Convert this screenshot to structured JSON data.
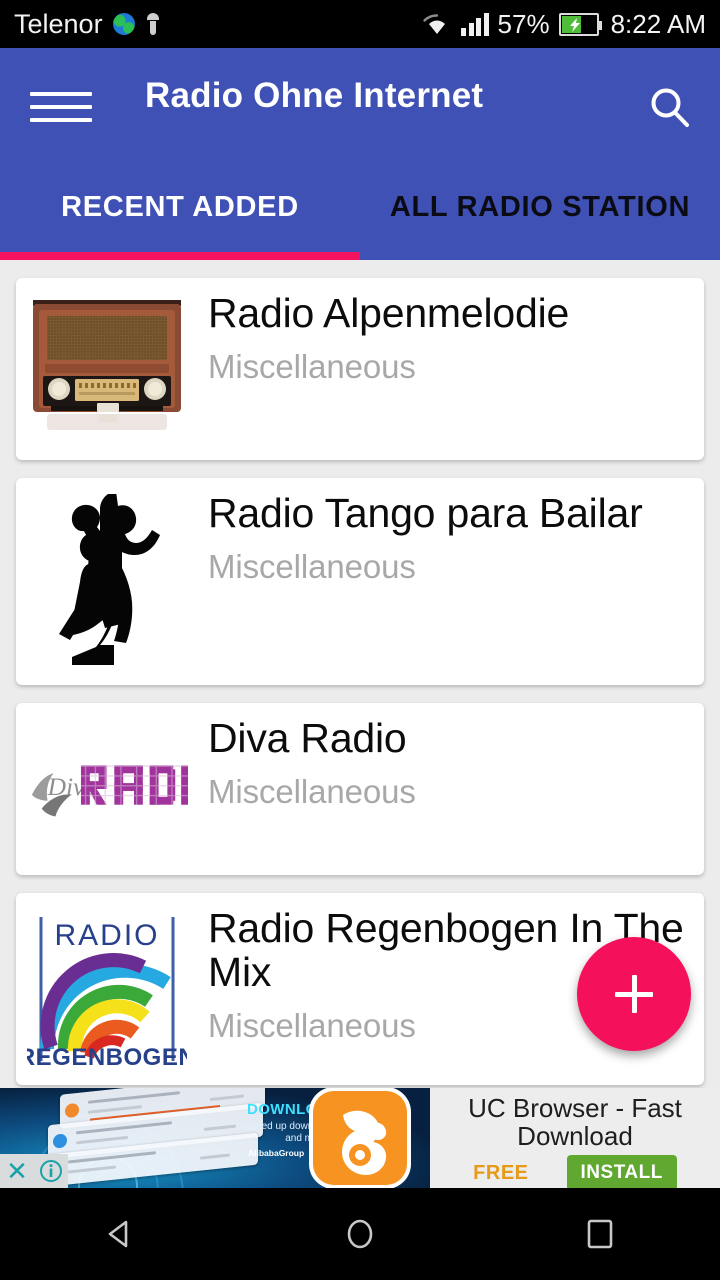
{
  "statusbar": {
    "carrier": "Telenor",
    "battery_percent": "57%",
    "clock": "8:22 AM",
    "icons": [
      "globe-icon",
      "android-icon",
      "wifi-icon",
      "signal-icon",
      "battery-icon"
    ]
  },
  "appbar": {
    "title": "Radio Ohne Internet",
    "menu_icon": "hamburger-menu-icon",
    "search_icon": "search-icon",
    "background_color": "#3f51b5",
    "indicator_color": "#f5125e"
  },
  "tabs": [
    {
      "label": "RECENT ADDED",
      "active": true
    },
    {
      "label": "ALL RADIO STATION",
      "active": false
    }
  ],
  "stations": [
    {
      "title": "Radio Alpenmelodie",
      "category": "Miscellaneous",
      "thumb": "vintage-radio-image"
    },
    {
      "title": "Radio Tango para Bailar",
      "category": "Miscellaneous",
      "thumb": "tango-dancers-silhouette"
    },
    {
      "title": "Diva Radio",
      "category": "Miscellaneous",
      "thumb": "diva-radio-logo"
    },
    {
      "title": "Radio Regenbogen In The Mix",
      "category": "Miscellaneous",
      "thumb": "radio-regenbogen-logo"
    }
  ],
  "fab": {
    "icon": "plus-icon",
    "color": "#f5105c"
  },
  "ad": {
    "headline": "DOWNLOAD FAST",
    "subtext": "Speed up downloading video and music",
    "brand_primary": "AlibabaGroup",
    "brand_secondary": "UCBrowser",
    "title": "UC Browser - Fast Download",
    "price_label": "FREE",
    "install_label": "INSTALL",
    "close_icon": "close-icon",
    "info_icon": "info-icon",
    "app_icon": "uc-browser-squirrel-icon"
  },
  "navbar": {
    "back": "back-triangle-icon",
    "home": "home-circle-icon",
    "recents": "recents-square-icon"
  }
}
